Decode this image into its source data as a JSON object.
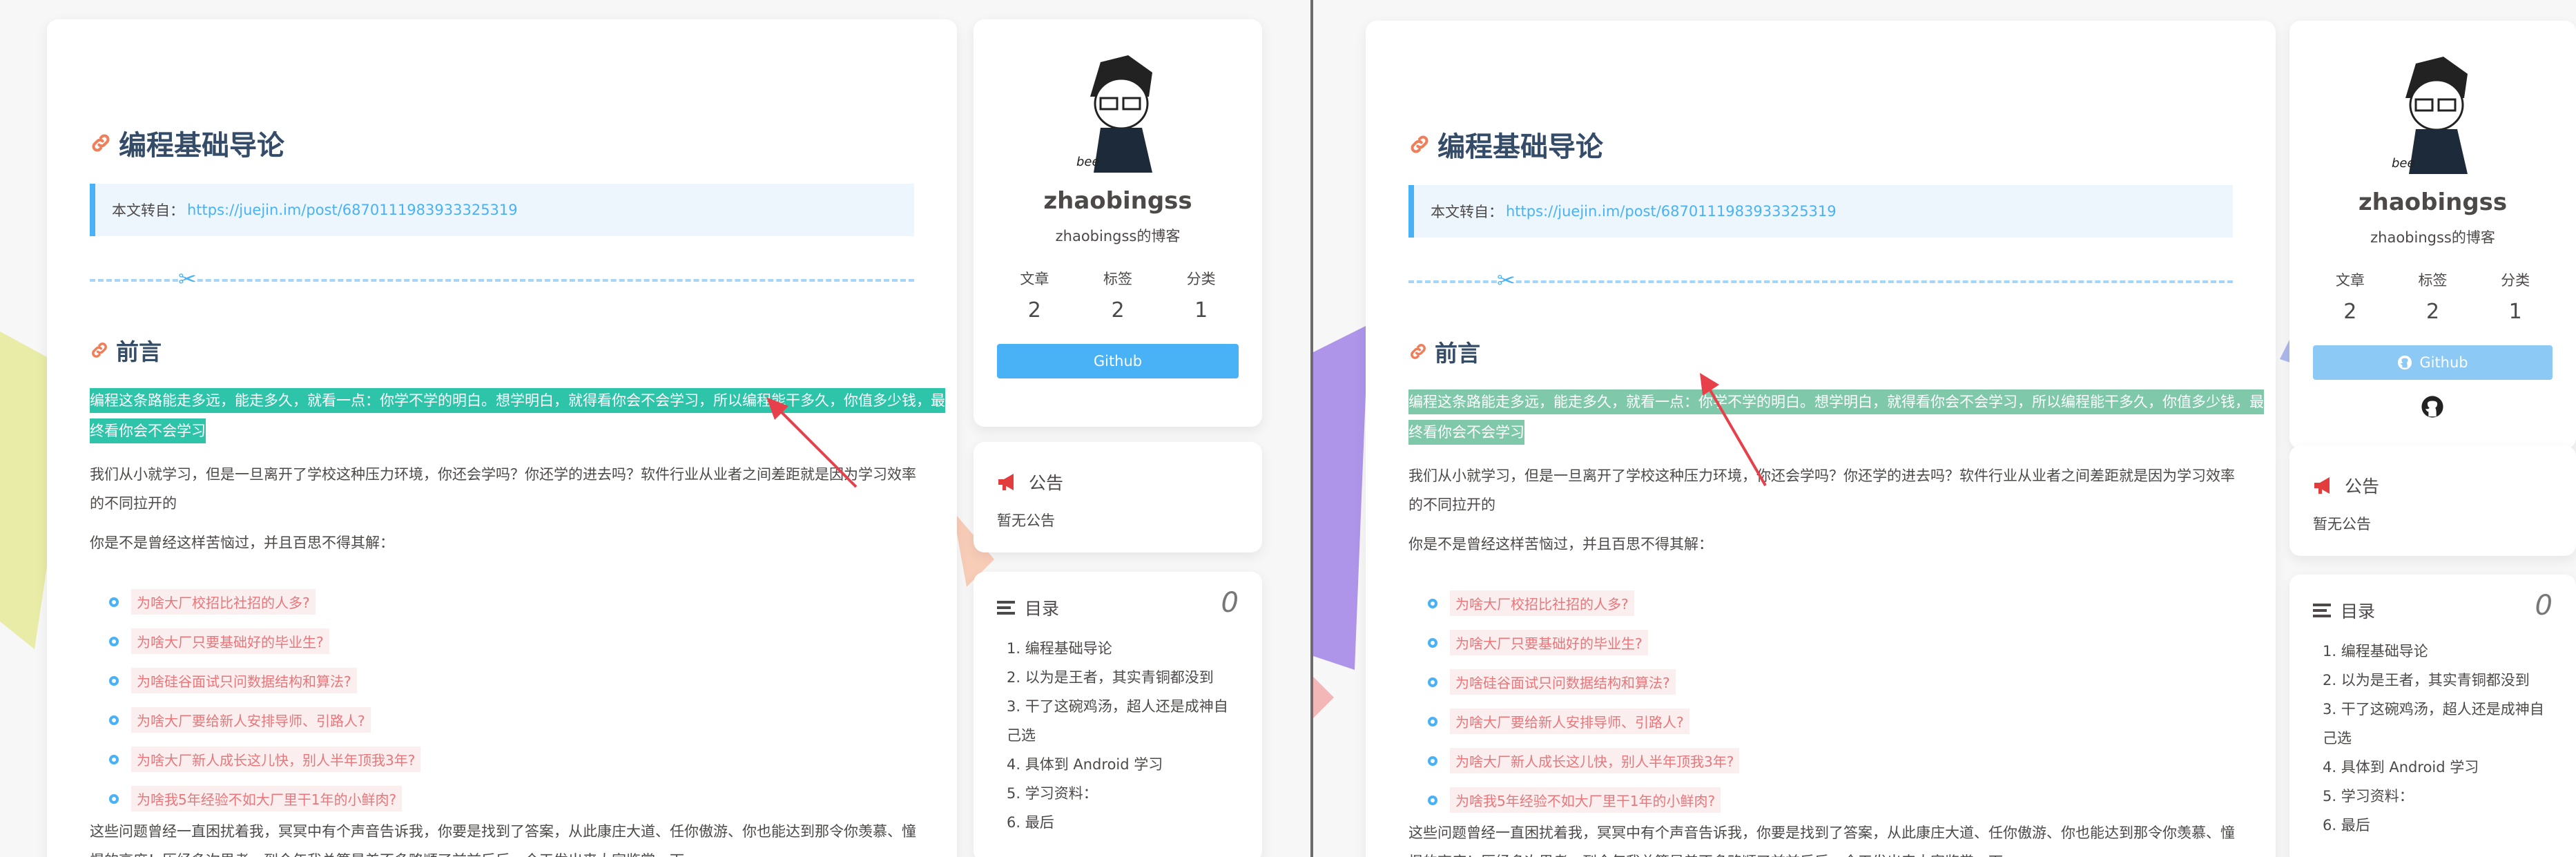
{
  "left": {
    "post": {
      "title": "编程基础导论",
      "repost_label": "本文转自：",
      "repost_url": "https://juejin.im/post/6870111983933325319",
      "heading": "前言",
      "highlight": "编程这条路能走多远，能走多久，就看一点：你学不学的明白。想学明白，就得看你会不会学习，所以编程能干多久，你值多少钱，最终看你会不会学习",
      "para1": "我们从小就学习，但是一旦离开了学校这种压力环境，你还会学吗？你还学的进去吗？软件行业从业者之间差距就是因为学习效率的不同拉开的",
      "para2": "你是不是曾经这样苦恼过，并且百思不得其解：",
      "questions": [
        "为啥大厂校招比社招的人多?",
        "为啥大厂只要基础好的毕业生?",
        "为啥硅谷面试只问数据结构和算法?",
        "为啥大厂要给新人安排导师、引路人?",
        "为啥大厂新人成长这儿快，别人半年顶我3年?",
        "为啥我5年经验不如大厂里干1年的小鲜肉?"
      ],
      "para3": "这些问题曾经一直困扰着我，冥冥中有个声音告诉我，你要是找到了答案，从此康庄大道、任你傲游、你也能达到那令你羡慕、憧憬的高度！历经多次思考，到今年我总算是差不多略顺了前前后后，今天发出来大家鉴赏一下"
    },
    "profile": {
      "author": "zhaobingss",
      "description": "zhaobingss的博客",
      "stats": [
        {
          "key": "文章",
          "value": "2"
        },
        {
          "key": "标签",
          "value": "2"
        },
        {
          "key": "分类",
          "value": "1"
        }
      ],
      "github_label": "Github"
    },
    "announcement": {
      "title": "公告",
      "body": "暂无公告"
    },
    "toc": {
      "title": "目录",
      "count": "0",
      "items": [
        "1. 编程基础导论",
        "2. 以为是王者，其实青铜都没到",
        "3. 干了这碗鸡汤，超人还是成神自",
        "己选",
        "4. 具体到 Android 学习",
        "5. 学习资料：",
        "6. 最后"
      ]
    }
  },
  "right": {
    "post": {
      "title": "编程基础导论",
      "repost_label": "本文转自：",
      "repost_url": "https://juejin.im/post/6870111983933325319",
      "heading": "前言",
      "highlight": "编程这条路能走多远，能走多久，就看一点：你学不学的明白。想学明白，就得看你会不会学习，所以编程能干多久，你值多少钱，最终看你会不会学习",
      "para1": "我们从小就学习，但是一旦离开了学校这种压力环境，你还会学吗？你还学的进去吗？软件行业从业者之间差距就是因为学习效率的不同拉开的",
      "para2": "你是不是曾经这样苦恼过，并且百思不得其解：",
      "questions": [
        "为啥大厂校招比社招的人多?",
        "为啥大厂只要基础好的毕业生?",
        "为啥硅谷面试只问数据结构和算法?",
        "为啥大厂要给新人安排导师、引路人?",
        "为啥大厂新人成长这儿快，别人半年顶我3年?",
        "为啥我5年经验不如大厂里干1年的小鲜肉?"
      ],
      "para3": "这些问题曾经一直困扰着我，冥冥中有个声音告诉我，你要是找到了答案，从此康庄大道、任你傲游、你也能达到那令你羡慕、憧憬的高度！历经多次思考，到今年我总算是差不多略顺了前前后后，今天发出来大家鉴赏一下"
    },
    "profile": {
      "author": "zhaobingss",
      "description": "zhaobingss的博客",
      "stats": [
        {
          "key": "文章",
          "value": "2"
        },
        {
          "key": "标签",
          "value": "2"
        },
        {
          "key": "分类",
          "value": "1"
        }
      ],
      "github_label": "Github"
    },
    "announcement": {
      "title": "公告",
      "body": "暂无公告"
    },
    "toc": {
      "title": "目录",
      "count": "0",
      "items": [
        "1. 编程基础导论",
        "2. 以为是王者，其实青铜都没到",
        "3. 干了这碗鸡汤，超人还是成神自",
        "己选",
        "4. 具体到 Android 学习",
        "5. 学习资料：",
        "6. 最后"
      ]
    }
  },
  "colors": {
    "accent": "#49b1f5",
    "highlight": "#2ec4a9",
    "title": "#344c67",
    "tag_text": "#e8767b",
    "tag_bg": "#fbeeee"
  }
}
